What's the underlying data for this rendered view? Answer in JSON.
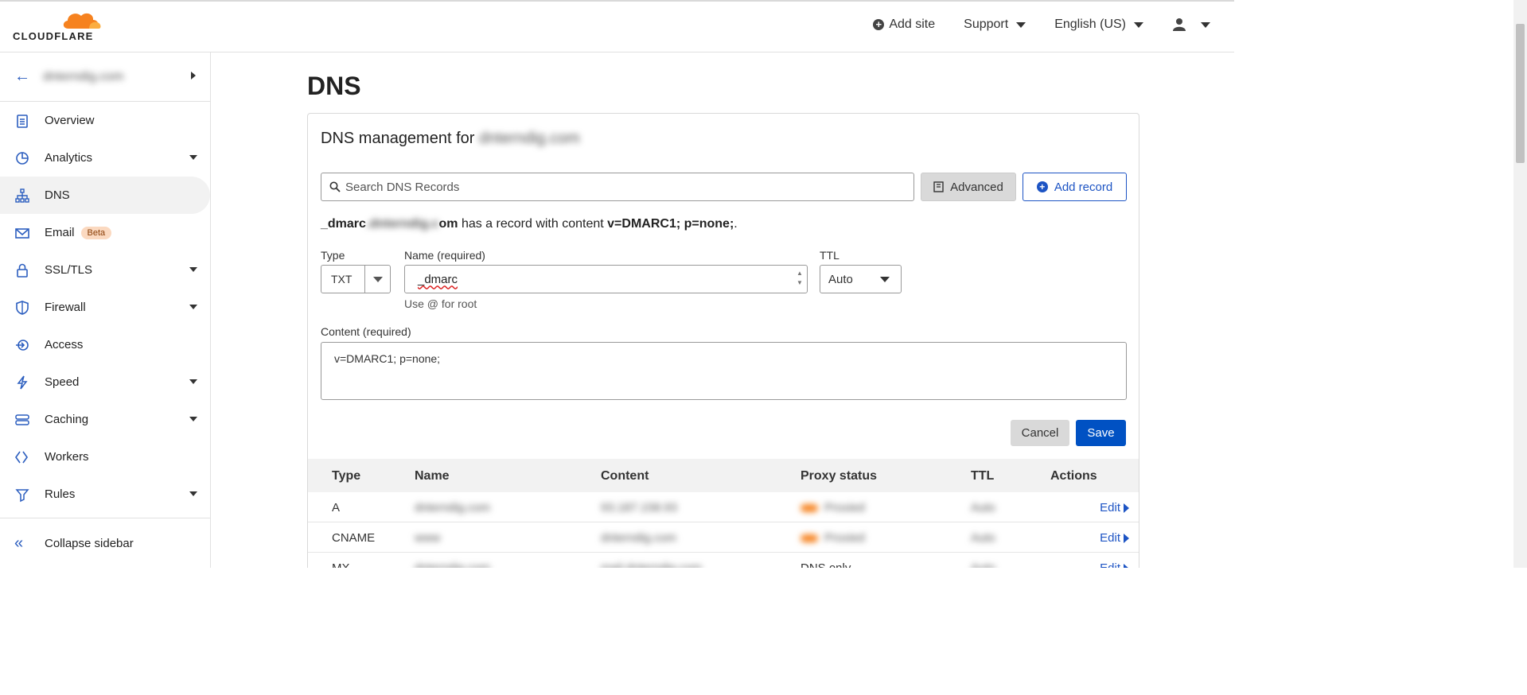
{
  "brand": {
    "logo_text": "CLOUDFLARE",
    "accent": "#f6821f",
    "primary": "#0051c3"
  },
  "topnav": {
    "add_site": "Add site",
    "support": "Support",
    "language": "English (US)"
  },
  "sidebar": {
    "site_name": "dnterndig.com",
    "items": [
      {
        "label": "Overview",
        "icon": "clipboard-icon"
      },
      {
        "label": "Analytics",
        "icon": "pie-chart-icon"
      },
      {
        "label": "DNS",
        "icon": "network-icon"
      },
      {
        "label": "Email",
        "icon": "envelope-icon",
        "badge": "Beta"
      },
      {
        "label": "SSL/TLS",
        "icon": "lock-icon"
      },
      {
        "label": "Firewall",
        "icon": "shield-icon"
      },
      {
        "label": "Access",
        "icon": "access-icon"
      },
      {
        "label": "Speed",
        "icon": "lightning-icon"
      },
      {
        "label": "Caching",
        "icon": "server-icon"
      },
      {
        "label": "Workers",
        "icon": "workers-icon"
      },
      {
        "label": "Rules",
        "icon": "funnel-icon"
      }
    ],
    "collapse": "Collapse sidebar"
  },
  "page": {
    "title": "DNS",
    "card_title_prefix": "DNS management for",
    "card_domain": "dnterndig.com",
    "search_placeholder": "Search DNS Records",
    "advanced": "Advanced",
    "add_record": "Add record",
    "summary": {
      "name_prefix": "_dmarc",
      "name_blurred": ".dnterndig.c",
      "name_suffix": "om",
      "middle": "has a record with content",
      "content": "v=DMARC1; p=none;",
      "end": "."
    }
  },
  "form": {
    "type_label": "Type",
    "type_value": "TXT",
    "name_label": "Name (required)",
    "name_value": "_dmarc",
    "name_hint": "Use @ for root",
    "ttl_label": "TTL",
    "ttl_value": "Auto",
    "content_label": "Content (required)",
    "content_value": "v=DMARC1; p=none;",
    "cancel": "Cancel",
    "save": "Save"
  },
  "table": {
    "headers": [
      "Type",
      "Name",
      "Content",
      "Proxy status",
      "TTL",
      "Actions"
    ],
    "rows": [
      {
        "type": "A",
        "name": "dnterndig.com",
        "content": "93.187.158.93",
        "proxy": "Proxied",
        "ttl": "Auto",
        "action": "Edit"
      },
      {
        "type": "CNAME",
        "name": "www",
        "content": "dnterndig.com",
        "proxy": "Proxied",
        "ttl": "Auto",
        "action": "Edit"
      },
      {
        "type": "MX",
        "name": "dnterndig.com",
        "content": "mail.dnterndig.com",
        "proxy": "DNS only",
        "ttl": "Auto",
        "action": "Edit"
      }
    ]
  }
}
